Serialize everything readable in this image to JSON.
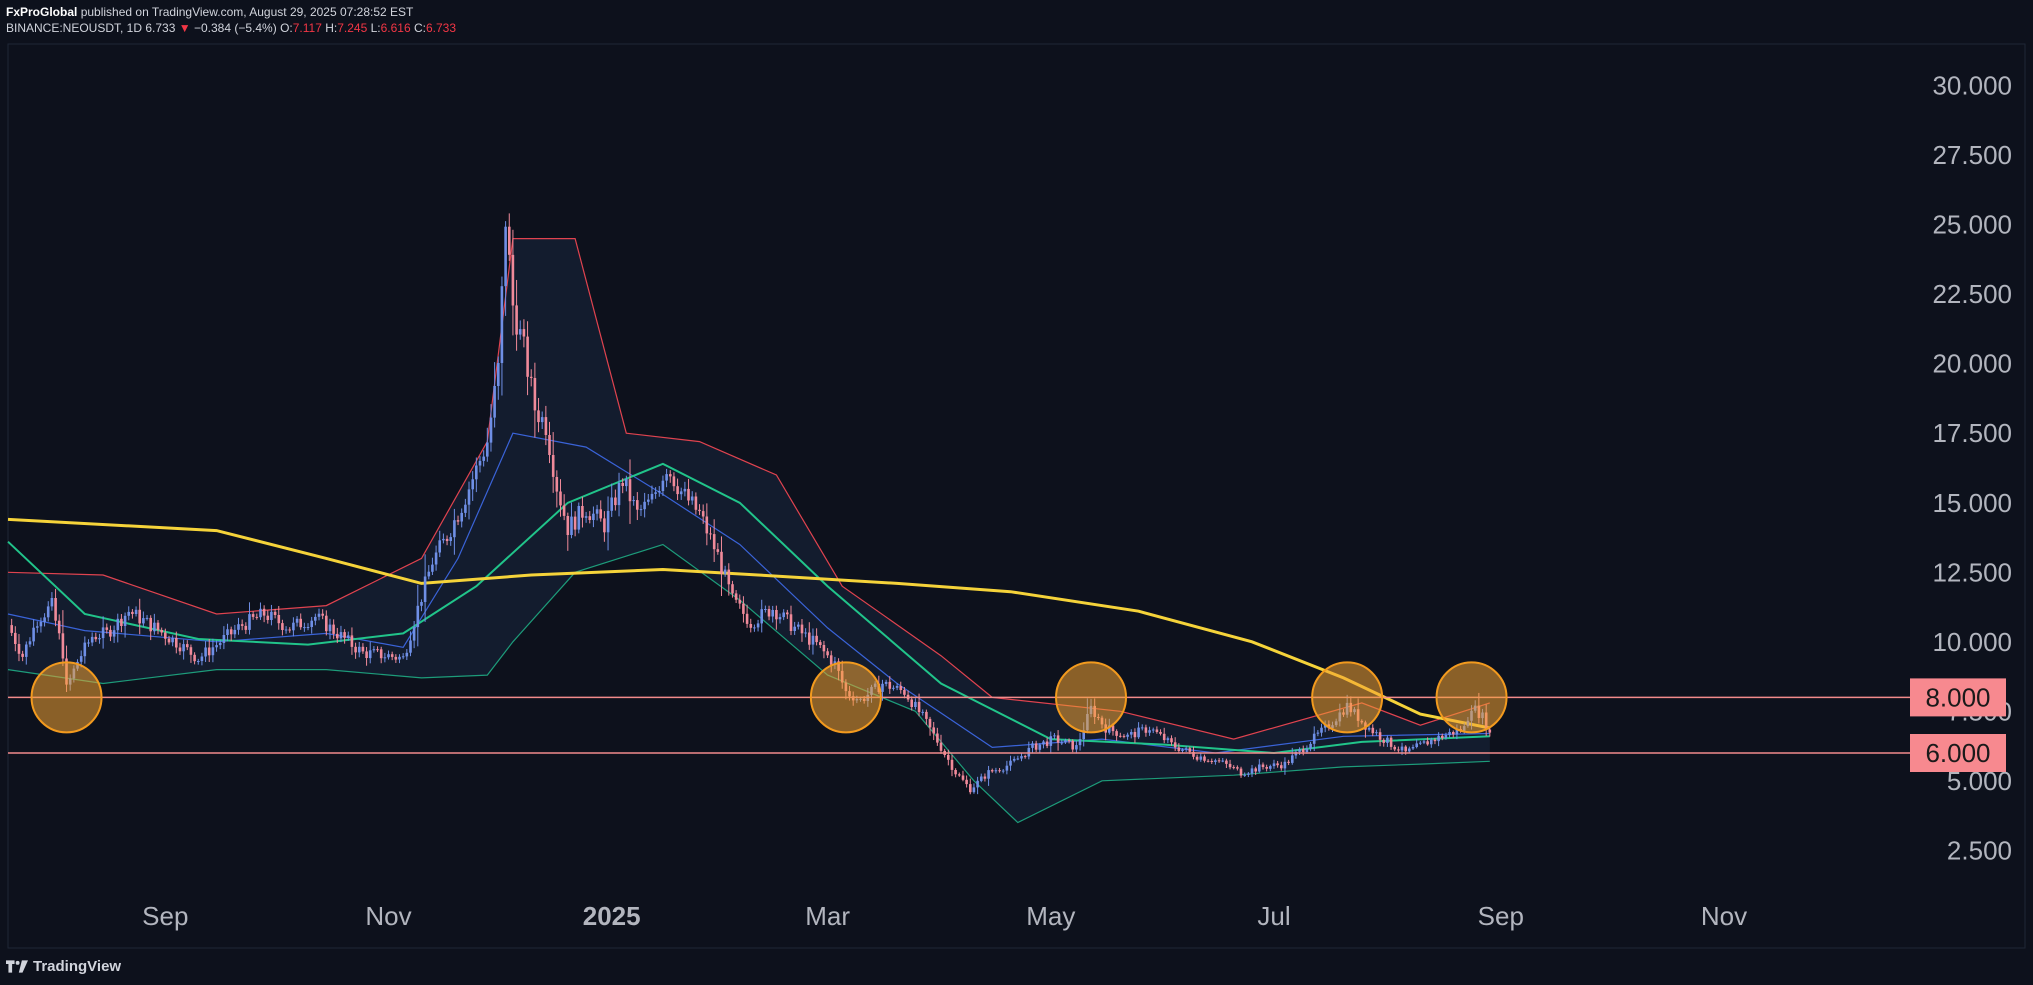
{
  "header": {
    "publisher": "FxProGlobal",
    "published_text": "published on TradingView.com, August 29, 2025 07:28:52 EST",
    "symbol": "BINANCE:NEOUSDT, 1D",
    "last": "6.733",
    "change": "−0.384 (−5.4%)",
    "o_label": "O:",
    "o": "7.117",
    "h_label": "H:",
    "h": "7.245",
    "l_label": "L:",
    "l": "6.616",
    "c_label": "C:",
    "c": "6.733"
  },
  "footer": {
    "brand": "TradingView"
  },
  "colors": {
    "background": "#0d111c",
    "bull": "#6f8fe6",
    "bear": "#f08a9a",
    "ma_yellow": "#f5d33a",
    "ma_green": "#21c48a",
    "bb_mid": "#3a63d8",
    "bb_upper": "#e0434f",
    "bb_lower": "#1d9c7a",
    "level_line": "#f28b8b",
    "label_bg": "#f7898f",
    "circle_fill": "#f3a233",
    "circle_stroke": "#f29a1e"
  },
  "chart_data": {
    "type": "candlestick",
    "symbol": "NEOUSDT",
    "timeframe": "1D",
    "y_ticks": [
      "30.000",
      "27.500",
      "25.000",
      "22.500",
      "20.000",
      "17.500",
      "15.000",
      "12.500",
      "10.000",
      "7.500",
      "5.000",
      "2.500"
    ],
    "y_tick_values": [
      30,
      27.5,
      25,
      22.5,
      20,
      17.5,
      15,
      12.5,
      10,
      7.5,
      5,
      2.5
    ],
    "ylim": [
      1.0,
      31.5
    ],
    "x_ticks": [
      "Sep",
      "Nov",
      "2025",
      "Mar",
      "May",
      "Jul",
      "Sep",
      "Nov"
    ],
    "x_tick_dates": [
      "2024-09-01",
      "2024-11-01",
      "2025-01-01",
      "2025-03-01",
      "2025-05-01",
      "2025-07-01",
      "2025-09-01",
      "2025-11-01"
    ],
    "x_range": [
      "2024-07-20",
      "2025-12-15"
    ],
    "grid": false,
    "horizontal_levels": [
      {
        "value": 8.0,
        "label": "8.000"
      },
      {
        "value": 6.0,
        "label": "6.000"
      }
    ],
    "highlight_circles": [
      {
        "date": "2024-08-05",
        "price": 8.0
      },
      {
        "date": "2025-03-06",
        "price": 8.0
      },
      {
        "date": "2025-05-12",
        "price": 8.0
      },
      {
        "date": "2025-07-21",
        "price": 8.0
      },
      {
        "date": "2025-08-24",
        "price": 8.0
      }
    ],
    "price_path": [
      [
        "2024-07-20",
        10.6
      ],
      [
        "2024-07-24",
        9.5
      ],
      [
        "2024-07-28",
        10.8
      ],
      [
        "2024-08-01",
        11.3
      ],
      [
        "2024-08-04",
        9.6
      ],
      [
        "2024-08-05",
        8.3
      ],
      [
        "2024-08-08",
        9.3
      ],
      [
        "2024-08-12",
        10.2
      ],
      [
        "2024-08-16",
        10.3
      ],
      [
        "2024-08-22",
        11.1
      ],
      [
        "2024-08-28",
        10.6
      ],
      [
        "2024-09-05",
        9.9
      ],
      [
        "2024-09-10",
        9.4
      ],
      [
        "2024-09-15",
        9.9
      ],
      [
        "2024-09-22",
        10.6
      ],
      [
        "2024-09-28",
        11.0
      ],
      [
        "2024-10-05",
        10.5
      ],
      [
        "2024-10-12",
        10.9
      ],
      [
        "2024-10-18",
        10.3
      ],
      [
        "2024-10-25",
        9.6
      ],
      [
        "2024-11-01",
        9.5
      ],
      [
        "2024-11-05",
        9.4
      ],
      [
        "2024-11-09",
        11.2
      ],
      [
        "2024-11-13",
        12.9
      ],
      [
        "2024-11-17",
        13.8
      ],
      [
        "2024-11-21",
        14.9
      ],
      [
        "2024-11-25",
        16.2
      ],
      [
        "2024-11-28",
        17.2
      ],
      [
        "2024-12-01",
        19.8
      ],
      [
        "2024-12-03",
        25.2
      ],
      [
        "2024-12-05",
        22.1
      ],
      [
        "2024-12-08",
        20.5
      ],
      [
        "2024-12-11",
        18.4
      ],
      [
        "2024-12-14",
        17.8
      ],
      [
        "2024-12-17",
        15.6
      ],
      [
        "2024-12-20",
        14.1
      ],
      [
        "2024-12-25",
        14.8
      ],
      [
        "2024-12-30",
        14.2
      ],
      [
        "2025-01-04",
        15.8
      ],
      [
        "2025-01-08",
        14.6
      ],
      [
        "2025-01-12",
        15.1
      ],
      [
        "2025-01-16",
        16.3
      ],
      [
        "2025-01-20",
        15.4
      ],
      [
        "2025-01-25",
        14.6
      ],
      [
        "2025-01-30",
        13.1
      ],
      [
        "2025-02-03",
        11.5
      ],
      [
        "2025-02-08",
        10.7
      ],
      [
        "2025-02-14",
        11.2
      ],
      [
        "2025-02-20",
        10.5
      ],
      [
        "2025-02-26",
        9.9
      ],
      [
        "2025-03-03",
        9.2
      ],
      [
        "2025-03-06",
        8.2
      ],
      [
        "2025-03-10",
        7.9
      ],
      [
        "2025-03-16",
        8.5
      ],
      [
        "2025-03-22",
        8.2
      ],
      [
        "2025-03-27",
        7.3
      ],
      [
        "2025-04-01",
        6.2
      ],
      [
        "2025-04-05",
        5.3
      ],
      [
        "2025-04-09",
        4.7
      ],
      [
        "2025-04-14",
        5.3
      ],
      [
        "2025-04-20",
        5.6
      ],
      [
        "2025-04-26",
        6.2
      ],
      [
        "2025-05-02",
        6.5
      ],
      [
        "2025-05-08",
        6.2
      ],
      [
        "2025-05-12",
        7.6
      ],
      [
        "2025-05-16",
        6.9
      ],
      [
        "2025-05-22",
        6.6
      ],
      [
        "2025-05-28",
        6.9
      ],
      [
        "2025-06-03",
        6.3
      ],
      [
        "2025-06-10",
        5.9
      ],
      [
        "2025-06-16",
        5.7
      ],
      [
        "2025-06-22",
        5.3
      ],
      [
        "2025-06-28",
        5.5
      ],
      [
        "2025-07-04",
        5.6
      ],
      [
        "2025-07-10",
        6.3
      ],
      [
        "2025-07-16",
        7.0
      ],
      [
        "2025-07-21",
        7.7
      ],
      [
        "2025-07-26",
        7.0
      ],
      [
        "2025-08-01",
        6.4
      ],
      [
        "2025-08-06",
        6.0
      ],
      [
        "2025-08-12",
        6.4
      ],
      [
        "2025-08-18",
        6.7
      ],
      [
        "2025-08-22",
        6.9
      ],
      [
        "2025-08-24",
        7.7
      ],
      [
        "2025-08-27",
        7.3
      ],
      [
        "2025-08-29",
        6.733
      ]
    ],
    "ma_slow_yellow": [
      [
        "2024-07-20",
        14.4
      ],
      [
        "2024-09-15",
        14.0
      ],
      [
        "2024-10-15",
        13.0
      ],
      [
        "2024-11-10",
        12.1
      ],
      [
        "2024-12-10",
        12.4
      ],
      [
        "2025-01-15",
        12.6
      ],
      [
        "2025-02-10",
        12.4
      ],
      [
        "2025-03-20",
        12.1
      ],
      [
        "2025-04-20",
        11.8
      ],
      [
        "2025-05-25",
        11.1
      ],
      [
        "2025-06-25",
        10.0
      ],
      [
        "2025-07-20",
        8.7
      ],
      [
        "2025-08-10",
        7.4
      ],
      [
        "2025-08-29",
        6.9
      ]
    ],
    "ma_fast_green": [
      [
        "2024-07-20",
        13.6
      ],
      [
        "2024-08-10",
        11.0
      ],
      [
        "2024-09-10",
        10.1
      ],
      [
        "2024-10-10",
        9.9
      ],
      [
        "2024-11-05",
        10.3
      ],
      [
        "2024-11-25",
        12.0
      ],
      [
        "2024-12-20",
        15.0
      ],
      [
        "2025-01-15",
        16.4
      ],
      [
        "2025-02-05",
        15.0
      ],
      [
        "2025-03-01",
        12.0
      ],
      [
        "2025-04-01",
        8.5
      ],
      [
        "2025-05-01",
        6.5
      ],
      [
        "2025-06-01",
        6.3
      ],
      [
        "2025-07-01",
        6.0
      ],
      [
        "2025-07-25",
        6.4
      ],
      [
        "2025-08-29",
        6.6
      ]
    ],
    "bollinger": {
      "mid": [
        [
          "2024-07-20",
          11.0
        ],
        [
          "2024-08-10",
          10.4
        ],
        [
          "2024-09-15",
          10.0
        ],
        [
          "2024-10-15",
          10.3
        ],
        [
          "2024-11-05",
          9.8
        ],
        [
          "2024-11-20",
          13.0
        ],
        [
          "2024-12-05",
          17.5
        ],
        [
          "2024-12-25",
          17.0
        ],
        [
          "2025-01-15",
          15.3
        ],
        [
          "2025-02-05",
          13.5
        ],
        [
          "2025-03-01",
          10.5
        ],
        [
          "2025-03-20",
          8.5
        ],
        [
          "2025-04-15",
          6.2
        ],
        [
          "2025-05-15",
          6.5
        ],
        [
          "2025-06-15",
          6.0
        ],
        [
          "2025-07-20",
          6.6
        ],
        [
          "2025-08-29",
          6.7
        ]
      ],
      "upper": [
        [
          "2024-07-20",
          12.5
        ],
        [
          "2024-08-15",
          12.4
        ],
        [
          "2024-09-15",
          11.0
        ],
        [
          "2024-10-15",
          11.3
        ],
        [
          "2024-11-10",
          13.0
        ],
        [
          "2024-11-28",
          17.2
        ],
        [
          "2024-12-05",
          24.5
        ],
        [
          "2024-12-22",
          24.5
        ],
        [
          "2025-01-05",
          17.5
        ],
        [
          "2025-01-25",
          17.2
        ],
        [
          "2025-02-15",
          16.0
        ],
        [
          "2025-03-05",
          12.0
        ],
        [
          "2025-04-01",
          9.5
        ],
        [
          "2025-04-15",
          8.0
        ],
        [
          "2025-05-20",
          7.5
        ],
        [
          "2025-06-20",
          6.5
        ],
        [
          "2025-07-25",
          7.8
        ],
        [
          "2025-08-10",
          7.0
        ],
        [
          "2025-08-29",
          7.8
        ]
      ],
      "lower": [
        [
          "2024-07-20",
          9.0
        ],
        [
          "2024-08-15",
          8.5
        ],
        [
          "2024-09-15",
          9.0
        ],
        [
          "2024-10-15",
          9.0
        ],
        [
          "2024-11-10",
          8.7
        ],
        [
          "2024-11-28",
          8.8
        ],
        [
          "2024-12-05",
          10.0
        ],
        [
          "2024-12-22",
          12.5
        ],
        [
          "2025-01-15",
          13.5
        ],
        [
          "2025-02-05",
          11.5
        ],
        [
          "2025-03-01",
          8.8
        ],
        [
          "2025-03-25",
          7.5
        ],
        [
          "2025-04-10",
          5.0
        ],
        [
          "2025-04-22",
          3.5
        ],
        [
          "2025-05-15",
          5.0
        ],
        [
          "2025-06-20",
          5.2
        ],
        [
          "2025-07-20",
          5.5
        ],
        [
          "2025-08-10",
          5.6
        ],
        [
          "2025-08-29",
          5.7
        ]
      ]
    }
  }
}
